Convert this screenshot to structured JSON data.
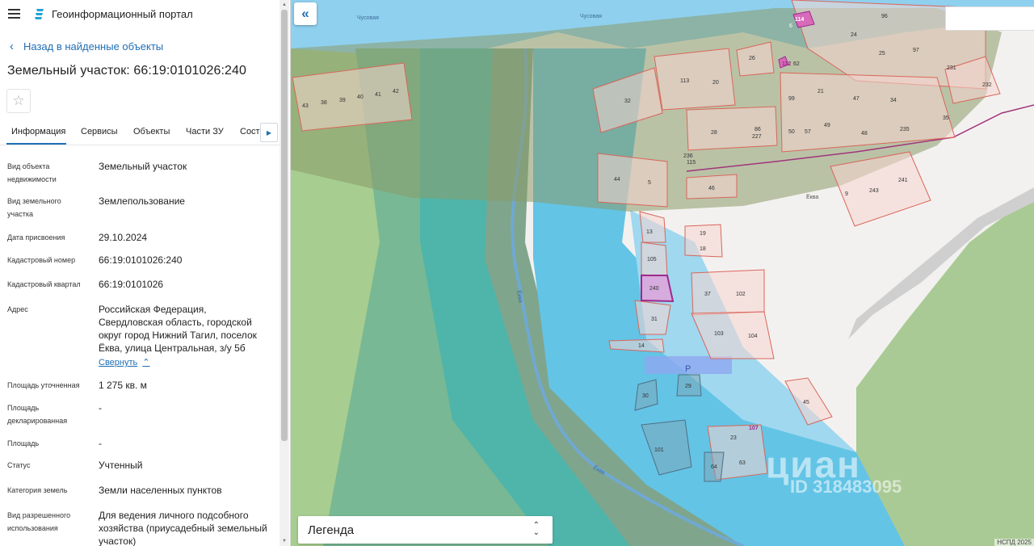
{
  "header": {
    "app_title": "Геоинформационный портал"
  },
  "back_link": "Назад в найденные объекты",
  "page_title": "Земельный участок: 66:19:0101026:240",
  "tabs": [
    "Информация",
    "Сервисы",
    "Объекты",
    "Части ЗУ",
    "Соста"
  ],
  "attributes": [
    {
      "label": "Вид объекта недвижимости",
      "value": "Земельный участок"
    },
    {
      "label": "Вид земельного участка",
      "value": "Землепользование"
    },
    {
      "label": "Дата присвоения",
      "value": "29.10.2024"
    },
    {
      "label": "Кадастровый номер",
      "value": "66:19:0101026:240"
    },
    {
      "label": "Кадастровый квартал",
      "value": "66:19:0101026"
    },
    {
      "label": "Адрес",
      "value": "Российская Федерация, Свердловская область, городской округ город Нижний Тагил, поселок Ёква, улица Центральная, з/у 5б"
    },
    {
      "label": "Площадь уточненная",
      "value": "1 275 кв. м"
    },
    {
      "label": "Площадь декларированная",
      "value": "-"
    },
    {
      "label": "Площадь",
      "value": "-"
    },
    {
      "label": "Статус",
      "value": "Учтенный"
    },
    {
      "label": "Категория земель",
      "value": "Земли населенных пунктов"
    },
    {
      "label": "Вид разрешенного использования",
      "value": "Для ведения личного подсобного хозяйства (приусадебный земельный участок)"
    }
  ],
  "collapse_label": "Свернуть",
  "map": {
    "legend_label": "Легенда",
    "copyright": "НСПД 2025",
    "watermark_logo": "циан",
    "watermark_id": "ID 318483095",
    "river_labels": [
      "Чусовая",
      "Чусовая",
      "Ёква",
      "Ёква"
    ],
    "place_label": "Ёква",
    "parking_label": "P",
    "parcel_numbers": [
      "43",
      "38",
      "39",
      "40",
      "41",
      "42",
      "32",
      "113",
      "20",
      "26",
      "24",
      "96",
      "25",
      "97",
      "231",
      "232",
      "21",
      "47",
      "34",
      "35",
      "99",
      "28",
      "86",
      "227",
      "50",
      "57",
      "49",
      "48",
      "235",
      "236",
      "115",
      "44",
      "5",
      "46",
      "9",
      "243",
      "241",
      "13",
      "19",
      "18",
      "105",
      "240",
      "37",
      "102",
      "31",
      "103",
      "104",
      "14",
      "30",
      "29",
      "45",
      "101",
      "23",
      "107",
      "64",
      "63",
      "112",
      "62",
      "114",
      "6"
    ],
    "colors": {
      "water": "#8fd0ee",
      "river": "#6cc6ea",
      "forest": "#9bc38a",
      "zone_teal": "#48b7b0",
      "selected_parcel": "#b040a0",
      "parcel_fill": "#f6d6d0",
      "parcel_stroke": "#d9665a"
    }
  }
}
